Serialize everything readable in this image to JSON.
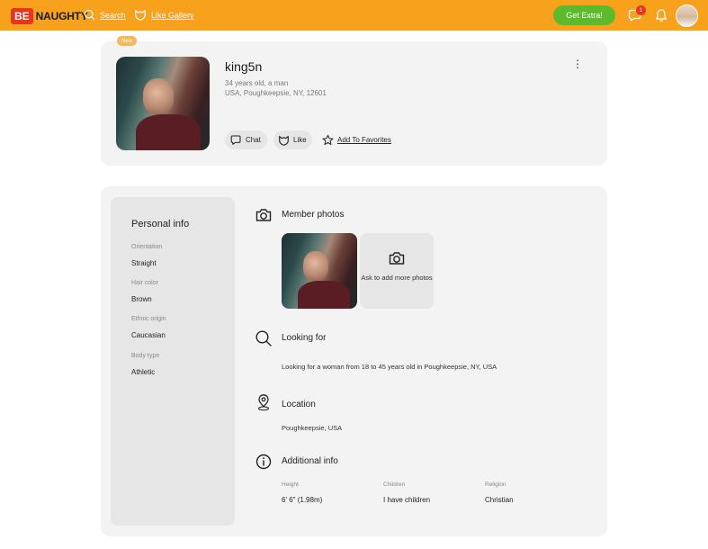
{
  "header": {
    "logo_be": "BE",
    "logo_naughty": "NAUGHTY",
    "search_label": "Search",
    "like_gallery_label": "Like Gallery",
    "get_extra_label": "Get Extra!",
    "notification_count": "1"
  },
  "profile": {
    "new_badge": "New",
    "username": "king5n",
    "age_gender": "34 years old, a man",
    "location_line": "USA, Poughkeepsie, NY, 12601",
    "more_menu": "⋮",
    "actions": {
      "chat": "Chat",
      "like": "Like",
      "favorites": "Add To Favorites"
    }
  },
  "personal_info": {
    "title": "Personal info",
    "fields": [
      {
        "label": "Orientation",
        "value": "Straight"
      },
      {
        "label": "Hair color",
        "value": "Brown"
      },
      {
        "label": "Ethnic origin",
        "value": "Caucasian"
      },
      {
        "label": "Body type",
        "value": "Athletic"
      }
    ]
  },
  "sections": {
    "member_photos": {
      "title": "Member photos",
      "ask_more": "Ask to add more photos"
    },
    "looking_for": {
      "title": "Looking for",
      "text": "Looking for a woman from 18 to 45 years old in Poughkeepsie, NY, USA"
    },
    "location": {
      "title": "Location",
      "text": "Poughkeepsie, USA"
    },
    "additional_info": {
      "title": "Additional info",
      "fields": [
        {
          "label": "Height",
          "value": "6' 6\" (1.98m)"
        },
        {
          "label": "Children",
          "value": "I have children"
        },
        {
          "label": "Religion",
          "value": "Christian"
        }
      ]
    }
  },
  "colors": {
    "header_bg": "#f7a11d",
    "cta_green": "#5dbb2b",
    "badge_red": "#e8351e",
    "card_bg": "#f3f3f3"
  },
  "icons": {
    "search": "search-icon",
    "like_gallery": "heart-cat-icon",
    "chat": "chat-icon",
    "notifications": "bell-icon",
    "camera": "camera-icon",
    "location": "location-pin-icon",
    "info": "info-icon",
    "star": "star-icon"
  }
}
